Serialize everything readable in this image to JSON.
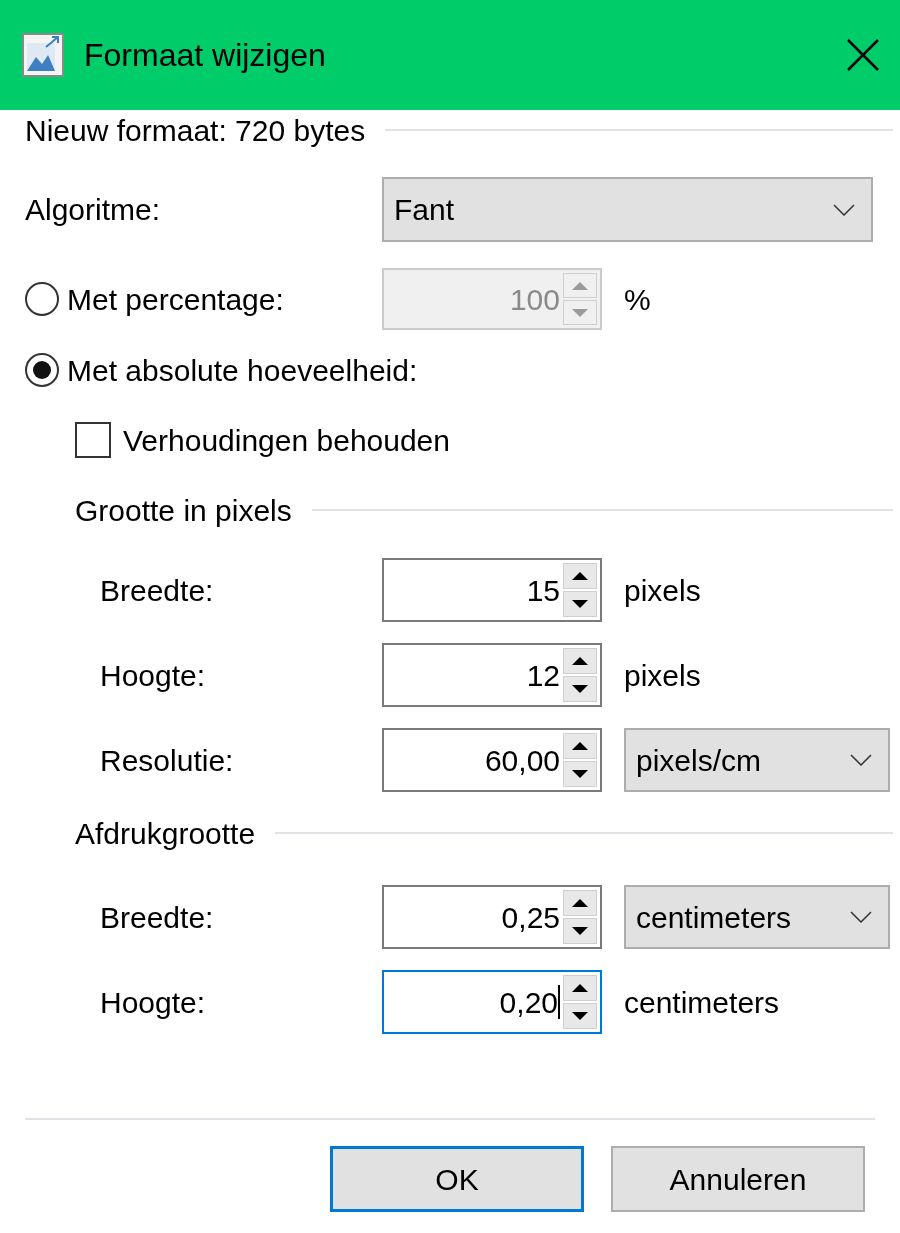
{
  "window": {
    "title": "Formaat wijzigen"
  },
  "new_size": "Nieuw formaat: 720 bytes",
  "algorithm": {
    "label": "Algoritme:",
    "value": "Fant"
  },
  "modes": [
    {
      "label": "Met percentage:",
      "selected": false,
      "field": {
        "value": "100",
        "disabled": true,
        "focused": false
      },
      "unit": "%"
    },
    {
      "label": "Met absolute hoeveelheid:",
      "selected": true
    }
  ],
  "keep_ratio": {
    "label": "Verhoudingen behouden",
    "checked": false
  },
  "sections": [
    {
      "title": "Grootte in pixels",
      "rows": [
        {
          "label": "Breedte:",
          "field": {
            "value": "15",
            "disabled": false,
            "focused": false
          },
          "unit": {
            "kind": "text",
            "text": "pixels"
          }
        },
        {
          "label": "Hoogte:",
          "field": {
            "value": "12",
            "disabled": false,
            "focused": false
          },
          "unit": {
            "kind": "text",
            "text": "pixels"
          }
        },
        {
          "label": "Resolutie:",
          "field": {
            "value": "60,00",
            "disabled": false,
            "focused": false
          },
          "unit": {
            "kind": "dropdown",
            "text": "pixels/cm"
          }
        }
      ]
    },
    {
      "title": "Afdrukgrootte",
      "rows": [
        {
          "label": "Breedte:",
          "field": {
            "value": "0,25",
            "disabled": false,
            "focused": false
          },
          "unit": {
            "kind": "dropdown",
            "text": "centimeters"
          }
        },
        {
          "label": "Hoogte:",
          "field": {
            "value": "0,20",
            "disabled": false,
            "focused": true
          },
          "unit": {
            "kind": "text",
            "text": "centimeters"
          }
        }
      ]
    }
  ],
  "buttons": [
    {
      "label": "OK",
      "default": true
    },
    {
      "label": "Annuleren",
      "default": false
    }
  ]
}
